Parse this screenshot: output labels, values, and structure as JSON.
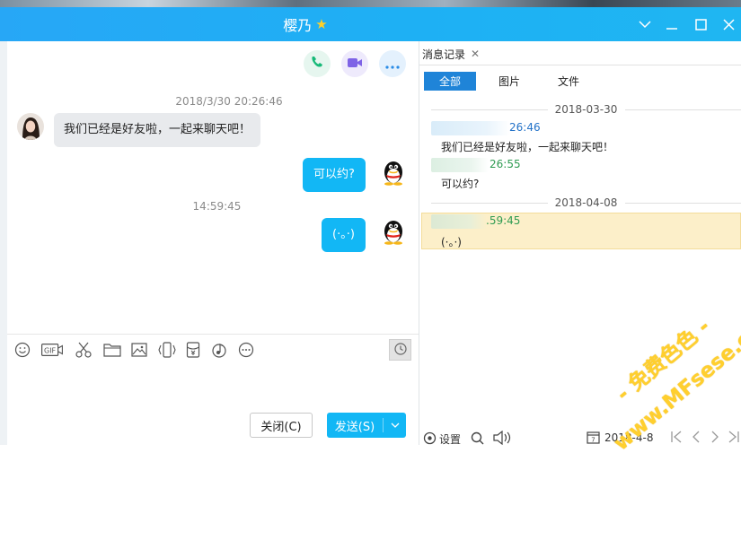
{
  "window": {
    "title": "樱乃",
    "controls": [
      "chevron-down",
      "minimize",
      "maximize",
      "close"
    ]
  },
  "chat": {
    "messages": [
      {
        "timestamp": "2018/3/30 20:26:46",
        "direction": "in",
        "text": "我们已经是好友啦，一起来聊天吧！"
      },
      {
        "direction": "out",
        "text": "可以约?"
      },
      {
        "timestamp": "14:59:45",
        "direction": "out",
        "text": "(·。·)"
      }
    ]
  },
  "toolbar": {
    "icons": [
      "emoji-icon",
      "gif-icon",
      "scissors-icon",
      "folder-icon",
      "image-icon",
      "shake-icon",
      "red-packet-icon",
      "music-icon",
      "more-icon",
      "clock-icon"
    ],
    "gif_label": "GIF"
  },
  "actions": {
    "close_label": "关闭(C)",
    "send_label": "发送(S)"
  },
  "history": {
    "tab_label": "消息记录",
    "filters": [
      "全部",
      "图片",
      "文件"
    ],
    "groups": [
      {
        "date": "2018-03-30",
        "entries": [
          {
            "time": "26:46",
            "text": "我们已经是好友啦，一起来聊天吧！",
            "color": "#2372c8"
          },
          {
            "time": "26:55",
            "text": "可以约?",
            "color": "#2f9b52"
          }
        ]
      },
      {
        "date": "2018-04-08",
        "entries": [
          {
            "time": ".59:45",
            "text": "(·。·)",
            "color": "#2f9b52",
            "highlighted": true
          }
        ]
      }
    ],
    "settings_label": "设置",
    "date_picker": "2018-4-8"
  },
  "watermark": {
    "line1": "- 免费色色 -",
    "line2": "www.MFsese.com"
  },
  "colors": {
    "accent": "#12b7f5",
    "title_bar": "#22acf4",
    "highlight": "#fcefc9"
  }
}
